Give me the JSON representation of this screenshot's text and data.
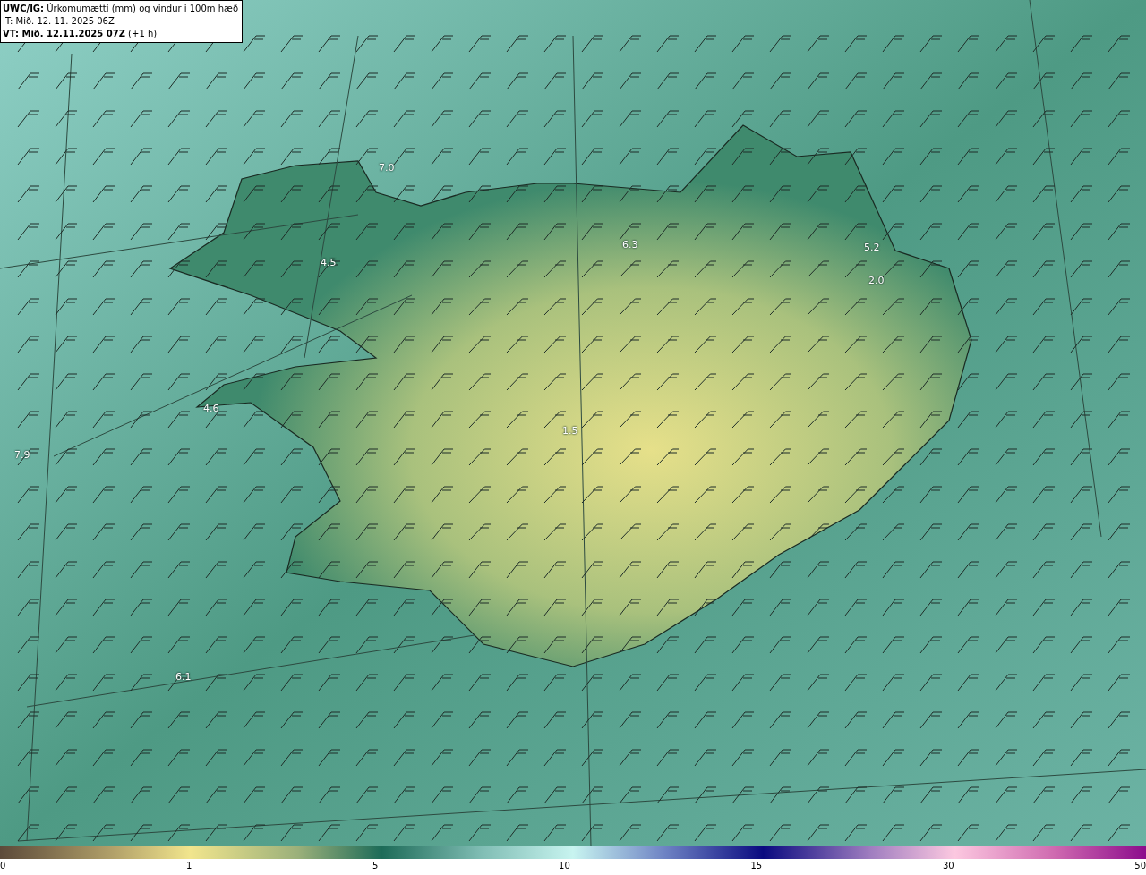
{
  "header": {
    "title": "**UWC/IG:** Úrkomumætti (mm) og vindur i 100m hæð",
    "issue_time": "IT: Mið. 12. 11. 2025 06Z",
    "valid_time": "**VT: Mið. 12.11.2025 07Z** (+1 h)"
  },
  "map": {
    "value_labels": [
      "7.0",
      "4.5",
      "6.3",
      "5.2",
      "2.0",
      "4.6",
      "7.9",
      "1.5",
      "6.1"
    ]
  },
  "colorbar": {
    "ticks": [
      "0",
      "1",
      "5",
      "10",
      "15",
      "30",
      "50"
    ]
  }
}
